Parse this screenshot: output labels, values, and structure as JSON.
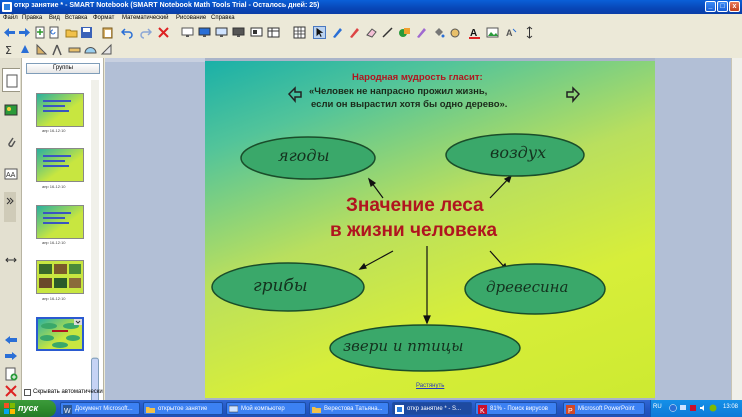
{
  "window": {
    "title": "откр занятие * - SMART Notebook (SMART Notebook Math Tools Trial - Осталось дней: 25)",
    "minimize": "_",
    "maximize": "□",
    "close": "x"
  },
  "menu": [
    "Файл",
    "Правка",
    "Вид",
    "Вставка",
    "Формат",
    "Математический",
    "Рисование",
    "Справка"
  ],
  "sorter": {
    "group_button": "Группы",
    "thumb_labels": [
      "апр 16-12:10",
      "апр 16-12:10",
      "апр 16-12:10",
      "апр 16-12:10",
      "апр 16-12:10"
    ],
    "auto_hide_label": "Скрывать автоматически"
  },
  "slide": {
    "wisdom_title": "Народная мудрость гласит:",
    "wisdom_line1": "«Человек не напрасно прожил жизнь,",
    "wisdom_line2": "если он вырастил хотя бы одно дерево».",
    "center_line1": "Значение леса",
    "center_line2": "в жизни человека",
    "nodes": {
      "berries": "ягоды",
      "air": "воздух",
      "mushrooms": "грибы",
      "wood": "древесина",
      "animals": "звери и птицы"
    },
    "expand_link": "Растянуть"
  },
  "taskbar": {
    "start": "пуск",
    "tasks": [
      "Документ Microsoft...",
      "открытое занятие",
      "Мой компьютер",
      "Верестова Татьяна...",
      "откр занятие * - S...",
      "81% - Поиск вирусов",
      "Microsoft PowerPoint"
    ],
    "lang": "RU",
    "clock": "13:08"
  },
  "colors": {
    "title_text": "#b0151f",
    "node_fill": "#3aa86a",
    "node_stroke": "#1a4d2a",
    "handwriting": "#14321e"
  }
}
